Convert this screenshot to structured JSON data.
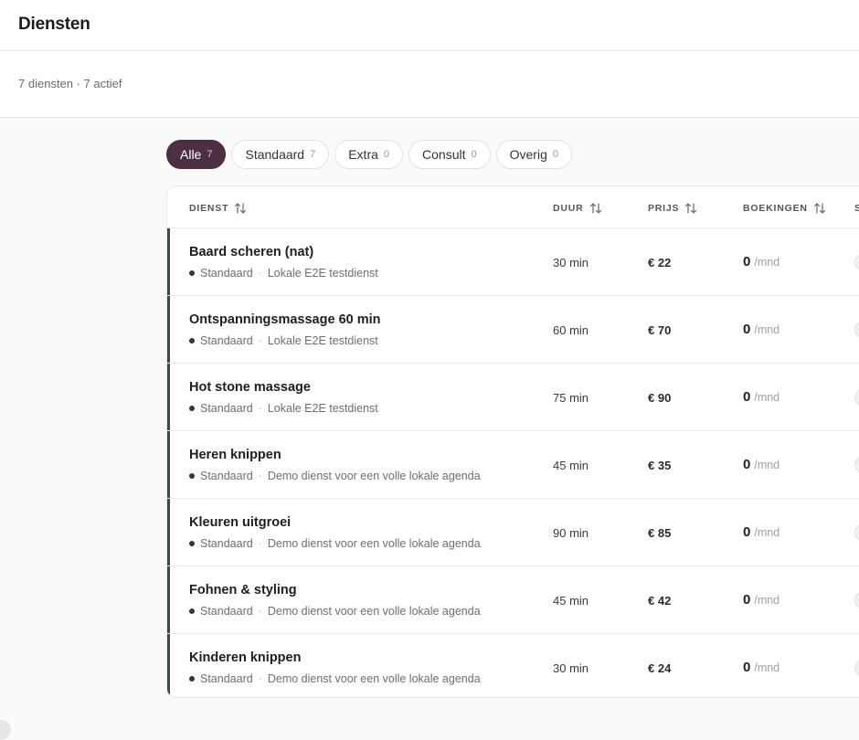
{
  "header": {
    "title": "Diensten"
  },
  "summary": {
    "text": "7 diensten · 7 actief"
  },
  "filters": [
    {
      "label": "Alle",
      "count": "7",
      "active": true
    },
    {
      "label": "Standaard",
      "count": "7",
      "active": false
    },
    {
      "label": "Extra",
      "count": "0",
      "active": false
    },
    {
      "label": "Consult",
      "count": "0",
      "active": false
    },
    {
      "label": "Overig",
      "count": "0",
      "active": false
    }
  ],
  "table": {
    "columns": {
      "dienst": "DIENST",
      "duur": "DUUR",
      "prijs": "PRIJS",
      "boekingen": "BOEKINGEN",
      "status_cut": "S"
    },
    "rows": [
      {
        "name": "Baard scheren (nat)",
        "category": "Standaard",
        "separator": "·",
        "description": "Lokale E2E testdienst",
        "duration": "30 min",
        "price": "€ 22",
        "bookings": "0",
        "bookings_unit": "/mnd"
      },
      {
        "name": "Ontspanningsmassage 60 min",
        "category": "Standaard",
        "separator": "·",
        "description": "Lokale E2E testdienst",
        "duration": "60 min",
        "price": "€ 70",
        "bookings": "0",
        "bookings_unit": "/mnd"
      },
      {
        "name": "Hot stone massage",
        "category": "Standaard",
        "separator": "·",
        "description": "Lokale E2E testdienst",
        "duration": "75 min",
        "price": "€ 90",
        "bookings": "0",
        "bookings_unit": "/mnd"
      },
      {
        "name": "Heren knippen",
        "category": "Standaard",
        "separator": "·",
        "description": "Demo dienst voor een volle lokale agenda",
        "duration": "45 min",
        "price": "€ 35",
        "bookings": "0",
        "bookings_unit": "/mnd"
      },
      {
        "name": "Kleuren uitgroei",
        "category": "Standaard",
        "separator": "·",
        "description": "Demo dienst voor een volle lokale agenda",
        "duration": "90 min",
        "price": "€ 85",
        "bookings": "0",
        "bookings_unit": "/mnd"
      },
      {
        "name": "Fohnen & styling",
        "category": "Standaard",
        "separator": "·",
        "description": "Demo dienst voor een volle lokale agenda",
        "duration": "45 min",
        "price": "€ 42",
        "bookings": "0",
        "bookings_unit": "/mnd"
      },
      {
        "name": "Kinderen knippen",
        "category": "Standaard",
        "separator": "·",
        "description": "Demo dienst voor een volle lokale agenda",
        "duration": "30 min",
        "price": "€ 24",
        "bookings": "0",
        "bookings_unit": "/mnd"
      }
    ]
  },
  "colors": {
    "accent_active_chip": "#4e2f42",
    "row_accent_bar": "#3a4b45"
  },
  "icons": {
    "sort": "sort-arrows-icon",
    "category_dot": "dot-icon"
  }
}
